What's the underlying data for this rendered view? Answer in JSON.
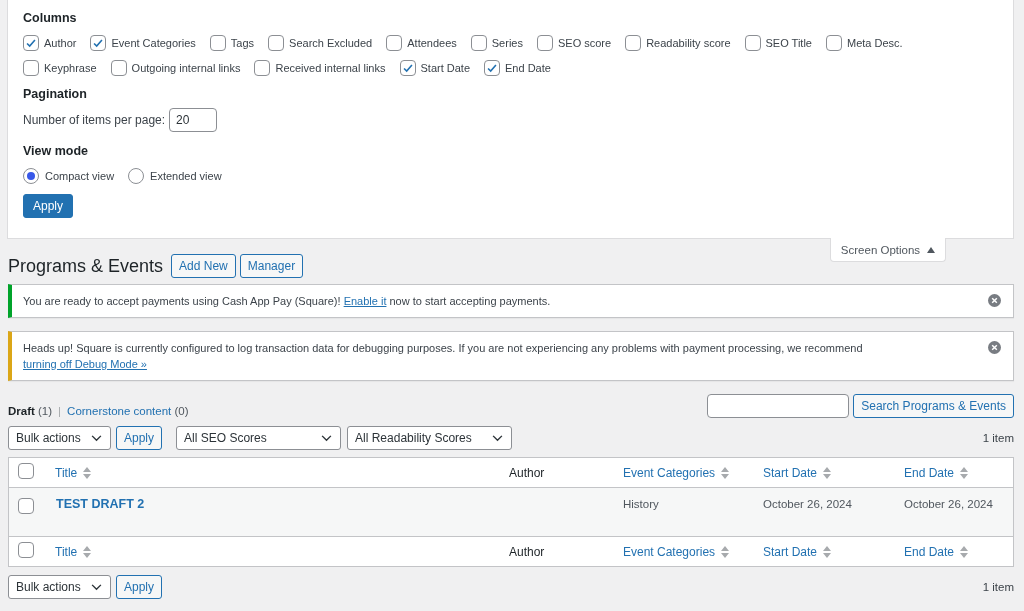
{
  "screen_options": {
    "expanded": true,
    "columns_heading": "Columns",
    "columns": [
      {
        "label": "Author",
        "checked": true
      },
      {
        "label": "Event Categories",
        "checked": true
      },
      {
        "label": "Tags",
        "checked": false
      },
      {
        "label": "Search Excluded",
        "checked": false
      },
      {
        "label": "Attendees",
        "checked": false
      },
      {
        "label": "Series",
        "checked": false
      },
      {
        "label": "SEO score",
        "checked": false
      },
      {
        "label": "Readability score",
        "checked": false
      },
      {
        "label": "SEO Title",
        "checked": false
      },
      {
        "label": "Meta Desc.",
        "checked": false
      },
      {
        "label": "Keyphrase",
        "checked": false
      },
      {
        "label": "Outgoing internal links",
        "checked": false
      },
      {
        "label": "Received internal links",
        "checked": false
      },
      {
        "label": "Start Date",
        "checked": true
      },
      {
        "label": "End Date",
        "checked": true
      }
    ],
    "pagination_heading": "Pagination",
    "items_per_page_label": "Number of items per page:",
    "items_per_page": "20",
    "view_mode_heading": "View mode",
    "view_modes": [
      {
        "label": "Compact view",
        "selected": true
      },
      {
        "label": "Extended view",
        "selected": false
      }
    ],
    "apply": "Apply",
    "toggle": "Screen Options"
  },
  "page_title": "Programs & Events",
  "header_buttons": [
    "Add New",
    "Manager"
  ],
  "notices": [
    {
      "kind": "success",
      "text_before": "You are ready to accept payments using Cash App Pay (Square)! ",
      "link": "Enable it",
      "text_after": " now to start accepting payments."
    },
    {
      "kind": "warning",
      "text_before": "Heads up! Square is currently configured to log transaction data for debugging purposes. If you are not experiencing any problems with payment processing, we recommend ",
      "link": "turning off Debug Mode »"
    }
  ],
  "views": [
    {
      "label": "Draft",
      "count": "(1)",
      "selected": true
    },
    {
      "label": "Cornerstone content",
      "count": "(0)",
      "selected": false
    }
  ],
  "views_separator": "|",
  "search_button": "Search Programs & Events",
  "top_nav": {
    "bulk_actions": "Bulk actions",
    "apply": "Apply",
    "filters": [
      "All SEO Scores",
      "All Readability Scores"
    ],
    "count": "1 item"
  },
  "table": {
    "header": {
      "select_all_checked": false,
      "columns": [
        {
          "label": "Title",
          "sortable": true
        },
        {
          "label": "Author",
          "sortable": false
        },
        {
          "label": "Event Categories",
          "sortable": true
        },
        {
          "label": "Start Date",
          "sortable": true
        },
        {
          "label": "End Date",
          "sortable": true
        }
      ]
    },
    "footer": {
      "select_all_checked": false,
      "columns": [
        {
          "label": "Title",
          "sortable": true
        },
        {
          "label": "Author",
          "sortable": false
        },
        {
          "label": "Event Categories",
          "sortable": true
        },
        {
          "label": "Start Date",
          "sortable": true
        },
        {
          "label": "End Date",
          "sortable": true
        }
      ]
    },
    "rows": [
      {
        "checked": false,
        "cells": [
          "TEST DRAFT 2",
          "",
          "History",
          "October 26, 2024",
          "October 26, 2024"
        ]
      }
    ]
  },
  "bottom_nav": {
    "bulk_actions": "Bulk actions",
    "apply": "Apply",
    "count": "1 item"
  }
}
